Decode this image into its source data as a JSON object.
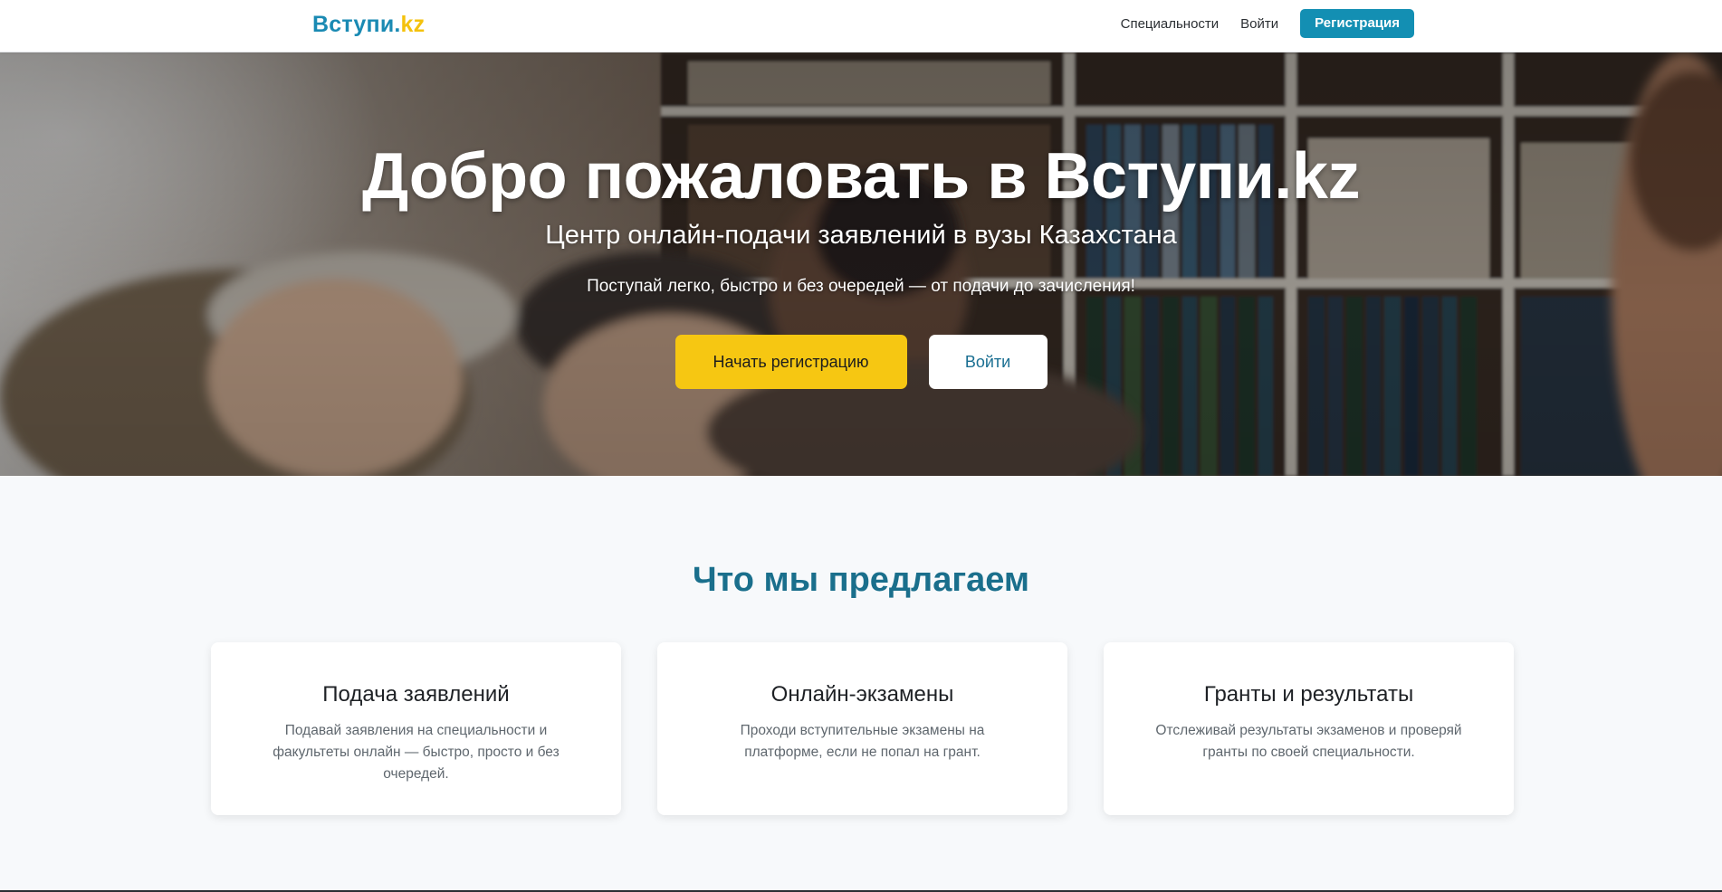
{
  "navbar": {
    "brand_main": "Вступи.",
    "brand_suffix": "kz",
    "links": [
      "Специальности",
      "Войти"
    ],
    "cta_label": "Регистрация"
  },
  "hero": {
    "title": "Добро пожаловать в Вступи.kz",
    "subtitle": "Центр онлайн-подачи заявлений в вузы Казахстана",
    "tagline": "Поступай легко, быстро и без очередей — от подачи до зачисления!",
    "primary_button": "Начать регистрацию",
    "secondary_button": "Войти"
  },
  "features": {
    "title": "Что мы предлагаем",
    "cards": [
      {
        "title": "Подача заявлений",
        "text": "Подавай заявления на специальности и факультеты онлайн — быстро, просто и без очередей."
      },
      {
        "title": "Онлайн-экзамены",
        "text": "Проходи вступительные экзамены на платформе, если не попал на грант."
      },
      {
        "title": "Гранты и результаты",
        "text": "Отслеживай результаты экзаменов и проверяй гранты по своей специальности."
      }
    ]
  },
  "colors": {
    "brand_blue": "#1a8ab3",
    "brand_yellow": "#f4c20d",
    "cta_blue": "#138fb3",
    "primary_yellow": "#f6c712",
    "section_title": "#1a6f8c",
    "page_background": "#f7f9fb"
  }
}
